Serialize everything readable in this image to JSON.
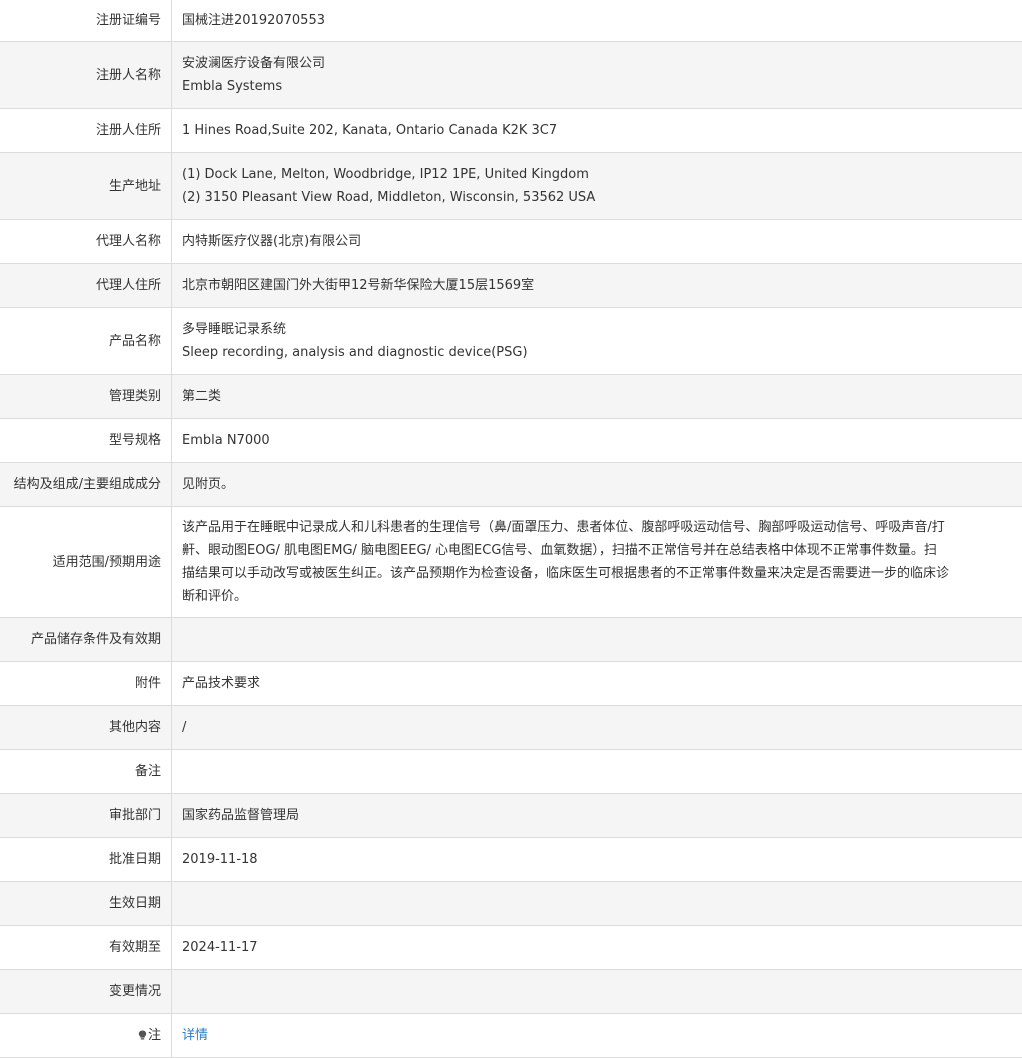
{
  "rows": [
    {
      "label": "注册证编号",
      "lines": [
        "国械注进20192070553"
      ]
    },
    {
      "label": "注册人名称",
      "lines": [
        "安波澜医疗设备有限公司",
        "Embla Systems"
      ]
    },
    {
      "label": "注册人住所",
      "lines": [
        "1 Hines Road,Suite 202, Kanata, Ontario Canada K2K 3C7"
      ]
    },
    {
      "label": "生产地址",
      "lines": [
        "(1) Dock Lane, Melton, Woodbridge, IP12 1PE, United Kingdom",
        "(2) 3150 Pleasant View Road, Middleton, Wisconsin, 53562 USA"
      ]
    },
    {
      "label": "代理人名称",
      "lines": [
        "内特斯医疗仪器(北京)有限公司"
      ]
    },
    {
      "label": "代理人住所",
      "lines": [
        "北京市朝阳区建国门外大街甲12号新华保险大厦15层1569室"
      ]
    },
    {
      "label": "产品名称",
      "lines": [
        "多导睡眠记录系统",
        "Sleep recording, analysis and diagnostic device(PSG)"
      ]
    },
    {
      "label": "管理类别",
      "lines": [
        "第二类"
      ]
    },
    {
      "label": "型号规格",
      "lines": [
        "Embla N7000"
      ]
    },
    {
      "label": "结构及组成/主要组成成分",
      "lines": [
        "见附页。"
      ]
    },
    {
      "label": "适用范围/预期用途",
      "lines": [
        "该产品用于在睡眠中记录成人和儿科患者的生理信号（鼻/面罩压力、患者体位、腹部呼吸运动信号、胸部呼吸运动信号、呼吸声音/打",
        "鼾、眼动图EOG/ 肌电图EMG/ 脑电图EEG/ 心电图ECG信号、血氧数据），扫描不正常信号并在总结表格中体现不正常事件数量。扫",
        "描结果可以手动改写或被医生纠正。该产品预期作为检查设备，临床医生可根据患者的不正常事件数量来决定是否需要进一步的临床诊",
        "断和评价。"
      ]
    },
    {
      "label": "产品储存条件及有效期",
      "lines": [
        ""
      ]
    },
    {
      "label": "附件",
      "lines": [
        "产品技术要求"
      ]
    },
    {
      "label": "其他内容",
      "lines": [
        "/"
      ]
    },
    {
      "label": "备注",
      "lines": [
        ""
      ]
    },
    {
      "label": "审批部门",
      "lines": [
        "国家药品监督管理局"
      ]
    },
    {
      "label": "批准日期",
      "lines": [
        "2019-11-18"
      ]
    },
    {
      "label": "生效日期",
      "lines": [
        ""
      ]
    },
    {
      "label": "有效期至",
      "lines": [
        "2024-11-17"
      ]
    },
    {
      "label": "变更情况",
      "lines": [
        ""
      ]
    }
  ],
  "note_row": {
    "label": "注",
    "icon": "lightbulb-icon",
    "link_text": "详情"
  },
  "colors": {
    "shaded_row": "#f5f5f5",
    "border": "#dcdcdc",
    "text": "#333333",
    "link": "#2a7dc8"
  }
}
